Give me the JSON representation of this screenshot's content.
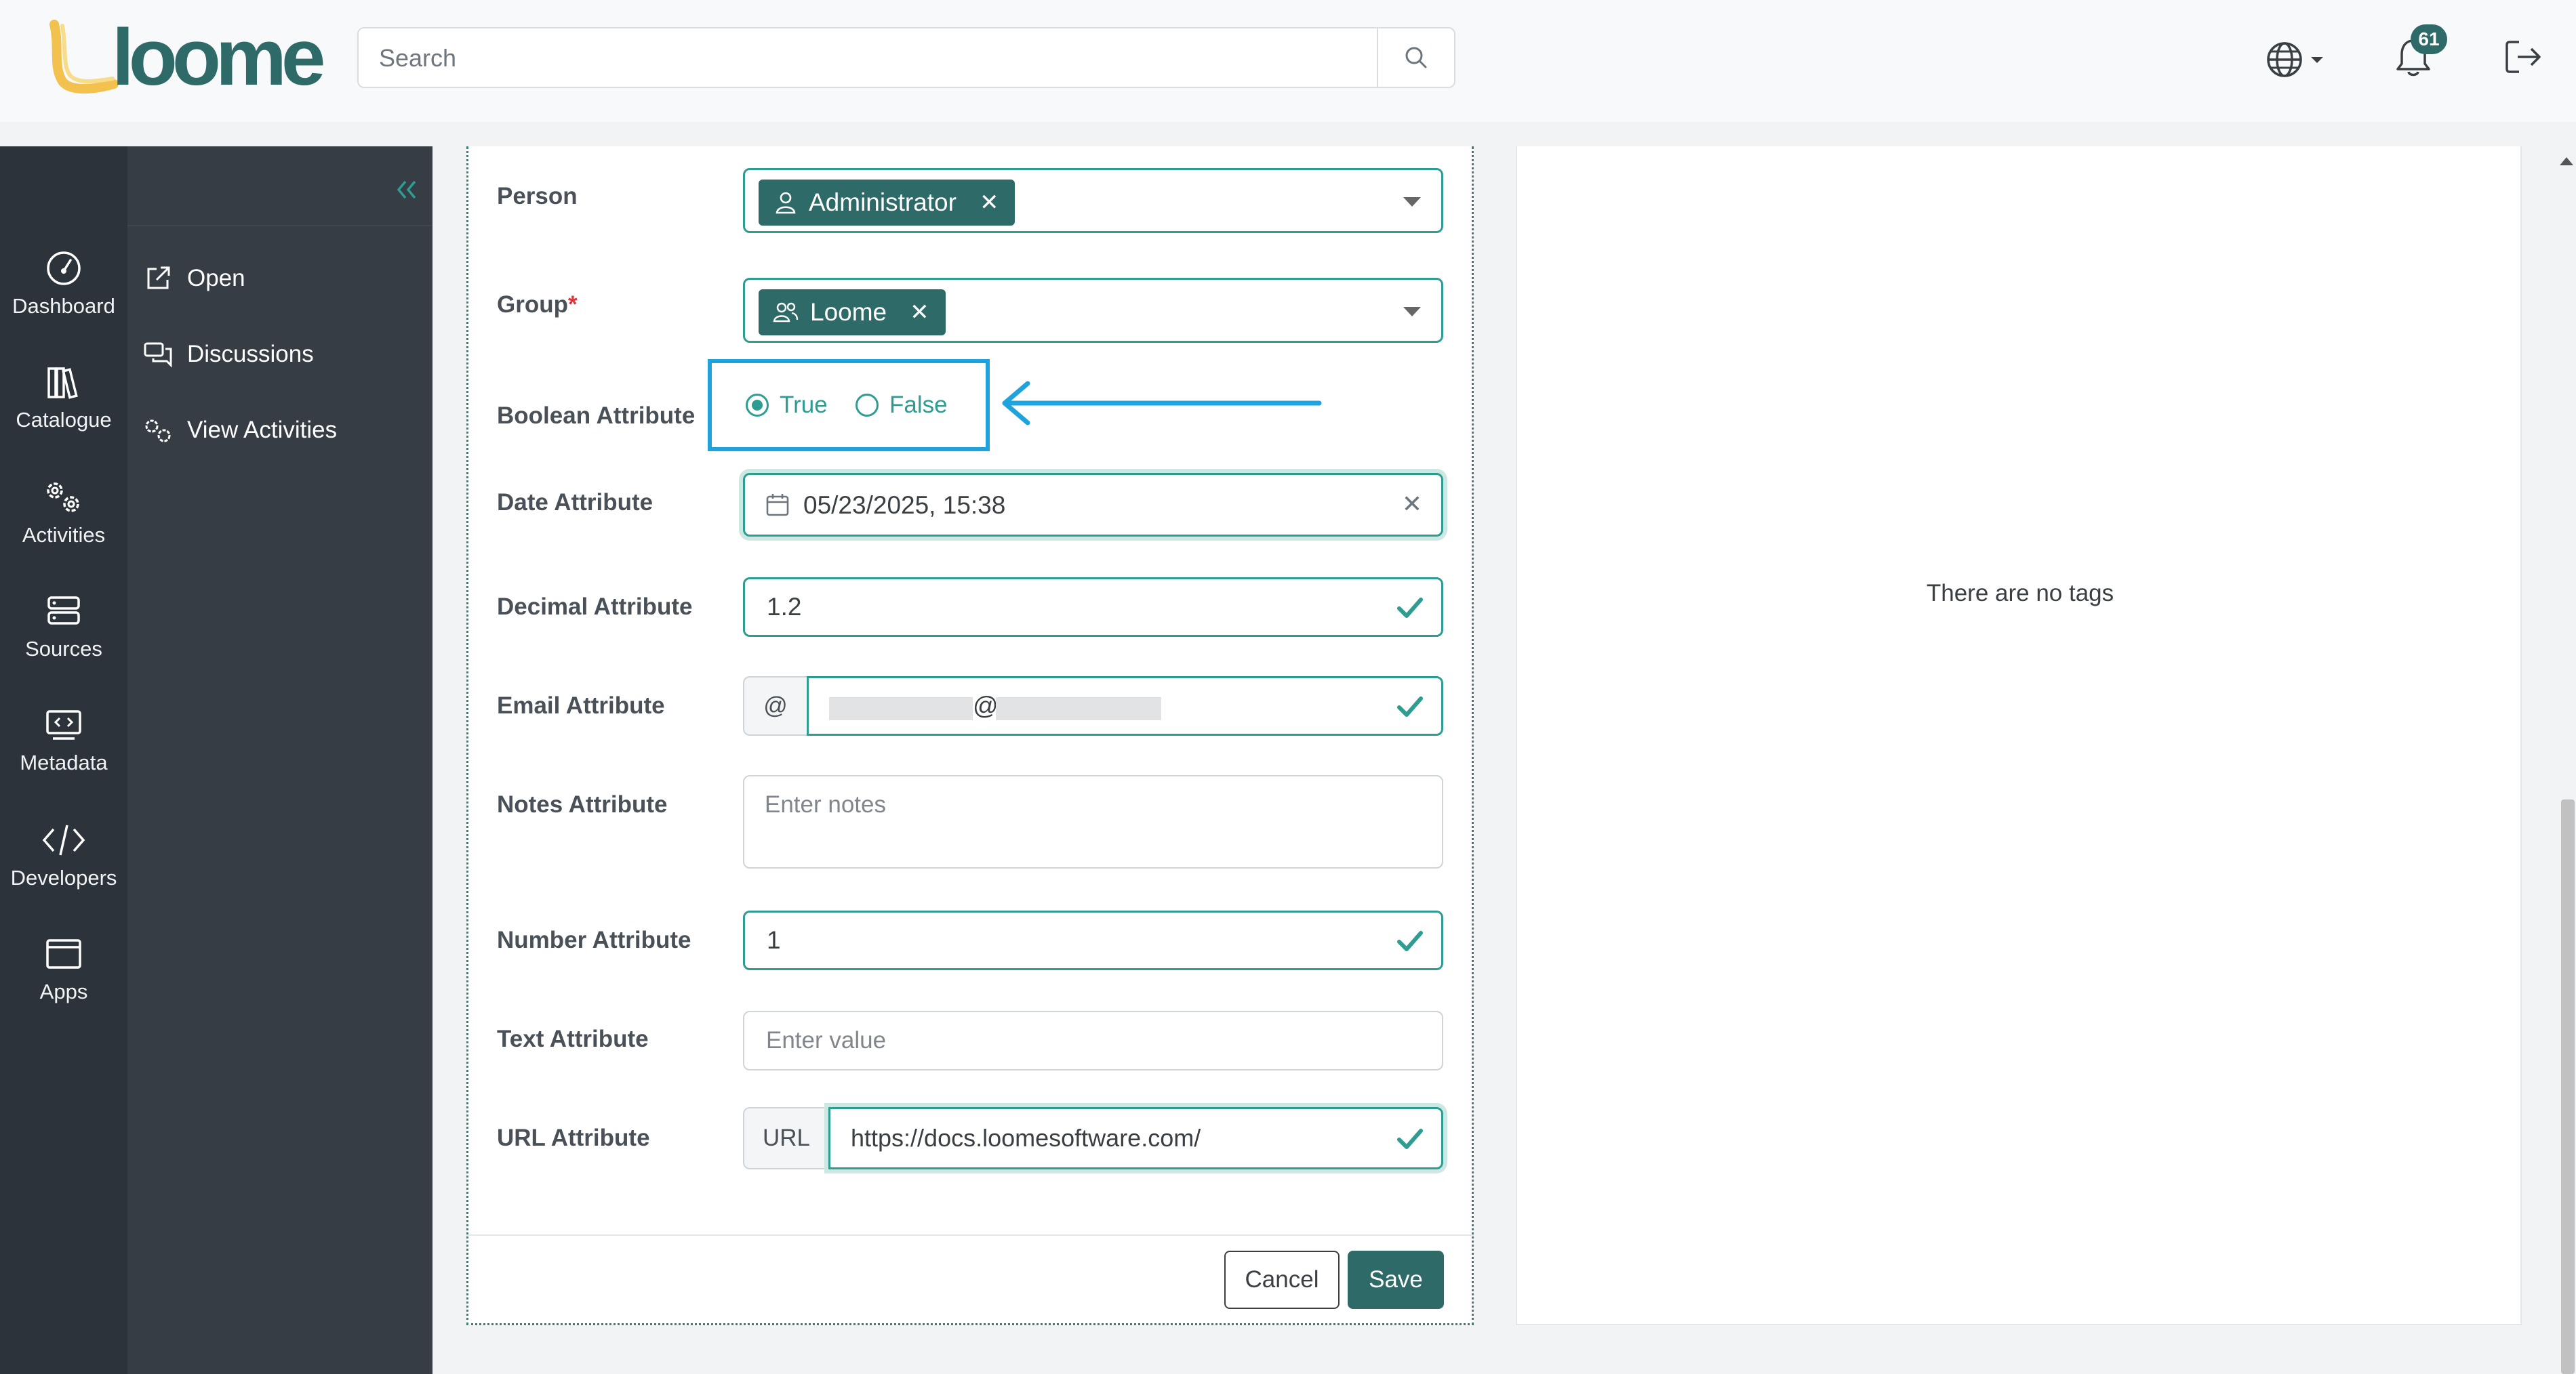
{
  "app": {
    "logo_text": "loome"
  },
  "search": {
    "placeholder": "Search"
  },
  "header": {
    "notification_count": "61"
  },
  "rail": {
    "items": [
      {
        "label": "Dashboard",
        "icon": "dashboard-icon"
      },
      {
        "label": "Catalogue",
        "icon": "catalogue-icon"
      },
      {
        "label": "Activities",
        "icon": "activities-icon"
      },
      {
        "label": "Sources",
        "icon": "sources-icon"
      },
      {
        "label": "Metadata",
        "icon": "metadata-icon"
      },
      {
        "label": "Developers",
        "icon": "developers-icon"
      },
      {
        "label": "Apps",
        "icon": "apps-icon"
      }
    ]
  },
  "subnav": {
    "items": [
      {
        "label": "Open",
        "icon": "external-link-icon"
      },
      {
        "label": "Discussions",
        "icon": "discussions-icon"
      },
      {
        "label": "View Activities",
        "icon": "activities-icon"
      }
    ]
  },
  "form": {
    "person": {
      "label": "Person",
      "chip": "Administrator"
    },
    "group": {
      "label": "Group",
      "required_mark": "*",
      "chip": "Loome"
    },
    "boolean": {
      "label": "Boolean Attribute",
      "options": [
        "True",
        "False"
      ],
      "selected": "True"
    },
    "date": {
      "label": "Date Attribute",
      "value": "05/23/2025, 15:38"
    },
    "decimal": {
      "label": "Decimal Attribute",
      "value": "1.2"
    },
    "email": {
      "label": "Email Attribute",
      "addon": "@",
      "at_symbol": "@"
    },
    "notes": {
      "label": "Notes Attribute",
      "placeholder": "Enter notes"
    },
    "number": {
      "label": "Number Attribute",
      "value": "1"
    },
    "text": {
      "label": "Text Attribute",
      "placeholder": "Enter value"
    },
    "url": {
      "label": "URL Attribute",
      "addon": "URL",
      "value": "https://docs.loomesoftware.com/"
    },
    "cancel_label": "Cancel",
    "save_label": "Save"
  },
  "tags": {
    "empty_text": "There are no tags"
  },
  "colors": {
    "accent": "#2e6a67",
    "valid": "#2f9c92",
    "highlight": "#1ea3dc",
    "sidebar": "#2d333b"
  }
}
